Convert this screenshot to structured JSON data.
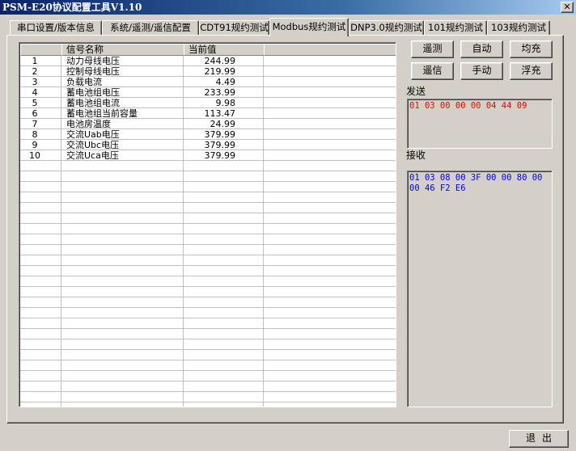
{
  "window": {
    "title": "PSM-E20协议配置工具V1.10",
    "close_label": "✕"
  },
  "tabs": [
    {
      "label": "串口设置/版本信息",
      "active": false
    },
    {
      "label": "系统/遥测/遥信配置",
      "active": false
    },
    {
      "label": "CDT91规约测试",
      "active": false
    },
    {
      "label": "Modbus规约测试",
      "active": true
    },
    {
      "label": "DNP3.0规约测试",
      "active": false
    },
    {
      "label": "101规约测试",
      "active": false
    },
    {
      "label": "103规约测试",
      "active": false
    }
  ],
  "table": {
    "columns": [
      "",
      "信号名称",
      "当前值",
      ""
    ],
    "rows": [
      {
        "no": "1",
        "name": "动力母线电压",
        "value": "244.99"
      },
      {
        "no": "2",
        "name": "控制母线电压",
        "value": "219.99"
      },
      {
        "no": "3",
        "name": "负载电流",
        "value": "4.49"
      },
      {
        "no": "4",
        "name": "蓄电池组电压",
        "value": "233.99"
      },
      {
        "no": "5",
        "name": "蓄电池组电流",
        "value": "9.98"
      },
      {
        "no": "6",
        "name": "蓄电池组当前容量",
        "value": "113.47"
      },
      {
        "no": "7",
        "name": "电池房温度",
        "value": "24.99"
      },
      {
        "no": "8",
        "name": "交流Uab电压",
        "value": "379.99"
      },
      {
        "no": "9",
        "name": "交流Ubc电压",
        "value": "379.99"
      },
      {
        "no": "10",
        "name": "交流Uca电压",
        "value": "379.99"
      }
    ]
  },
  "buttons": {
    "telemetry": "遥测",
    "auto": "自动",
    "equalize": "均充",
    "telesignal": "遥信",
    "manual": "手动",
    "float": "浮充"
  },
  "send": {
    "label": "发送",
    "hex": "01 03 00 00 00 04 44 09",
    "color": "#ff0000"
  },
  "receive": {
    "label": "接收",
    "hex": "01 03 08 00 3F 00 00 80 00 00 46 F2 E6",
    "color": "#0000ff"
  },
  "exit_label": "退出"
}
